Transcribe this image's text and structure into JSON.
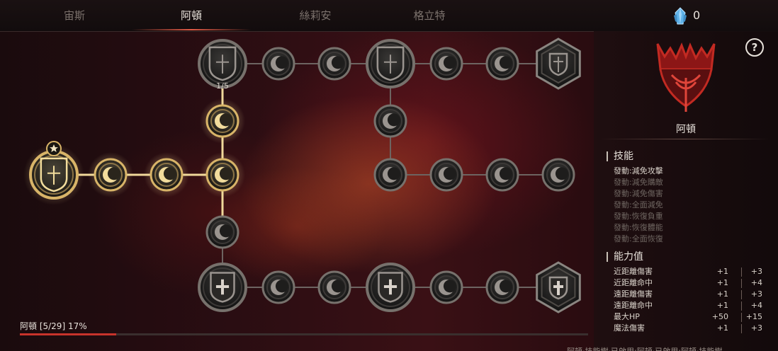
{
  "tabs": [
    {
      "label": "宙斯",
      "active": false
    },
    {
      "label": "阿頓",
      "active": true
    },
    {
      "label": "絲莉安",
      "active": false
    },
    {
      "label": "格立特",
      "active": false
    }
  ],
  "currency": {
    "icon": "blue-crystal-icon",
    "count": "0"
  },
  "help_label": "?",
  "character": {
    "name": "阿頓",
    "emblem": "red-flame-crown-emblem"
  },
  "node_counter": "1/5",
  "skills": {
    "title": "技能",
    "items": [
      {
        "label": "發動:減免攻擊",
        "unlocked": true
      },
      {
        "label": "發動:減免購敵",
        "unlocked": false
      },
      {
        "label": "發動:減免傷害",
        "unlocked": false
      },
      {
        "label": "發動:全面減免",
        "unlocked": false
      },
      {
        "label": "發動:恢復負重",
        "unlocked": false
      },
      {
        "label": "發動:恢復體能",
        "unlocked": false
      },
      {
        "label": "發動:全面恢復",
        "unlocked": false
      }
    ]
  },
  "stats": {
    "title": "能力值",
    "rows": [
      {
        "name": "近距離傷害",
        "current": "+1",
        "next": "+3"
      },
      {
        "name": "近距離命中",
        "current": "+1",
        "next": "+4"
      },
      {
        "name": "遠距離傷害",
        "current": "+1",
        "next": "+3"
      },
      {
        "name": "遠距離命中",
        "current": "+1",
        "next": "+4"
      },
      {
        "name": "最大HP",
        "current": "+50",
        "next": "+15"
      },
      {
        "name": "魔法傷害",
        "current": "+1",
        "next": "+3"
      }
    ]
  },
  "progress": {
    "label": "阿頓 [5/29] 17%",
    "fraction": 0.17
  },
  "colors": {
    "accent_red": "#c8332b",
    "gold": "#d8b468",
    "active_path": "#f0d89a",
    "text_light": "#e8e2db",
    "text_dim": "#7c726d"
  },
  "bottom_text": "阿頓·技能樹·已啟用:阿頓·已啟用:阿頓·技能樹"
}
